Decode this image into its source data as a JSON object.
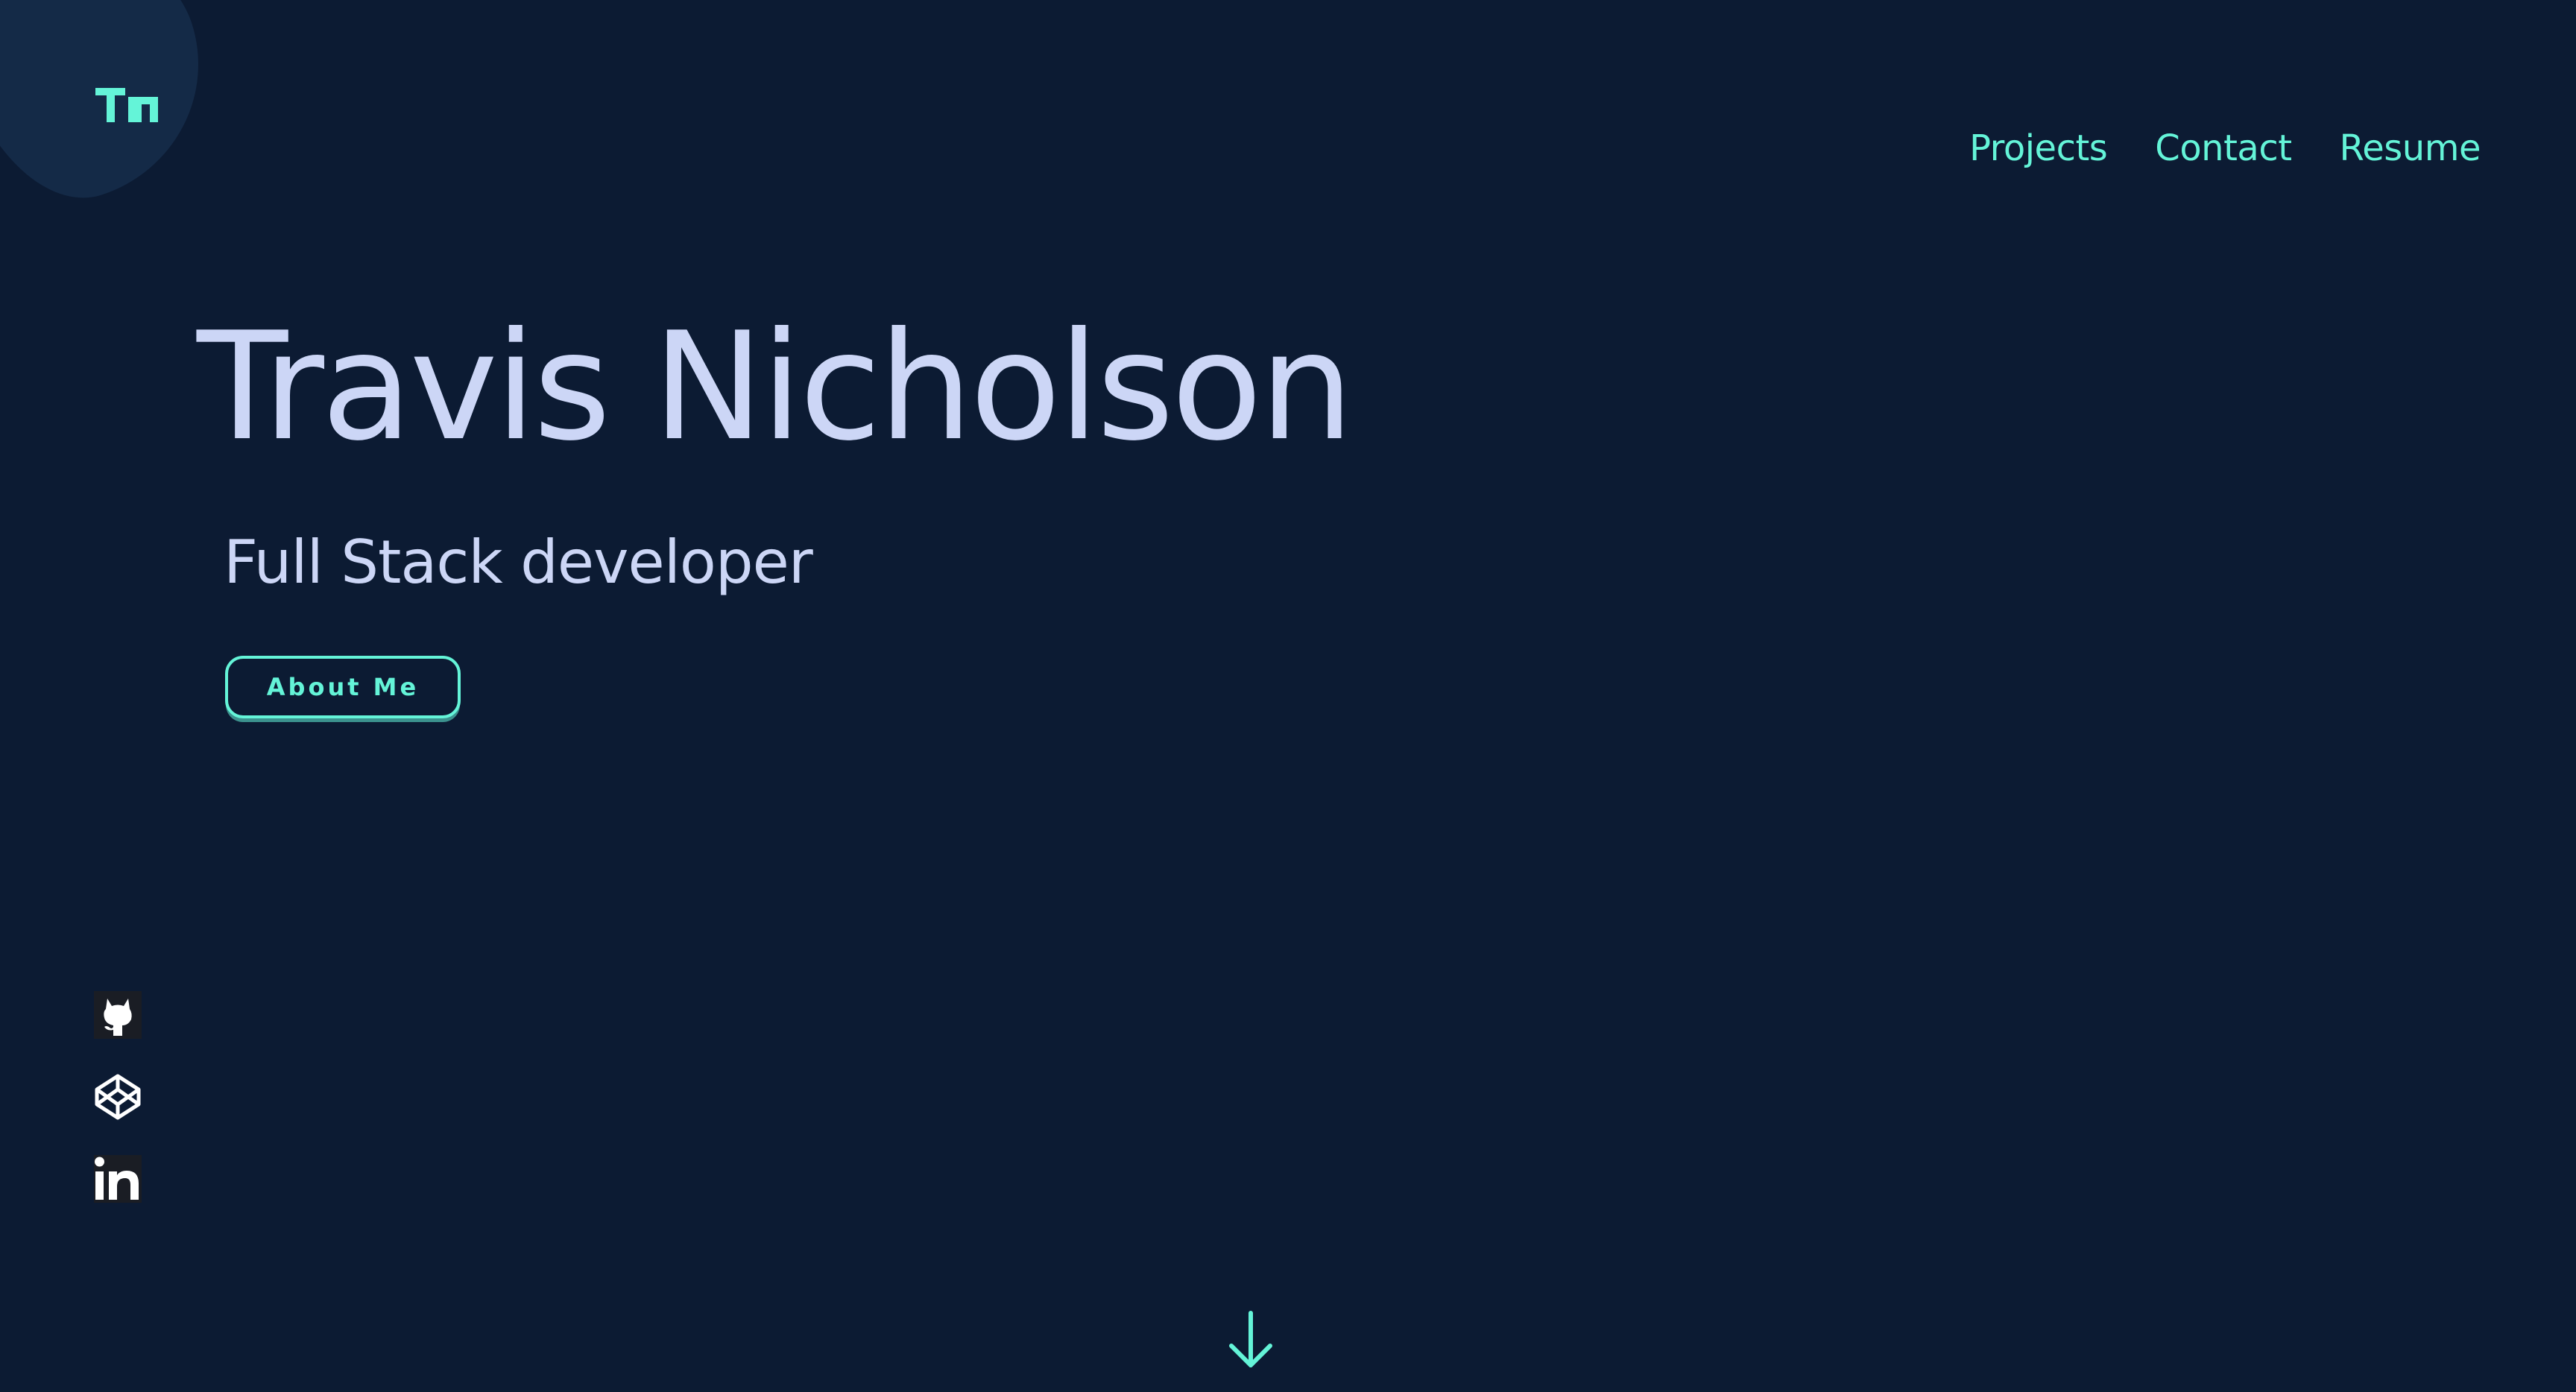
{
  "colors": {
    "background": "#0c1b33",
    "accent": "#64f4d8",
    "text": "#ccd6f6",
    "blob": "#142a47"
  },
  "header": {
    "logo_icon": "tn-monogram-icon",
    "nav": [
      {
        "label": "Projects"
      },
      {
        "label": "Contact"
      },
      {
        "label": "Resume"
      }
    ]
  },
  "hero": {
    "name": "Travis Nicholson",
    "role": "Full Stack developer",
    "cta_label": "About Me"
  },
  "socials": [
    {
      "icon": "github-icon"
    },
    {
      "icon": "codepen-icon"
    },
    {
      "icon": "linkedin-icon"
    }
  ],
  "scroll_icon": "arrow-down-icon"
}
